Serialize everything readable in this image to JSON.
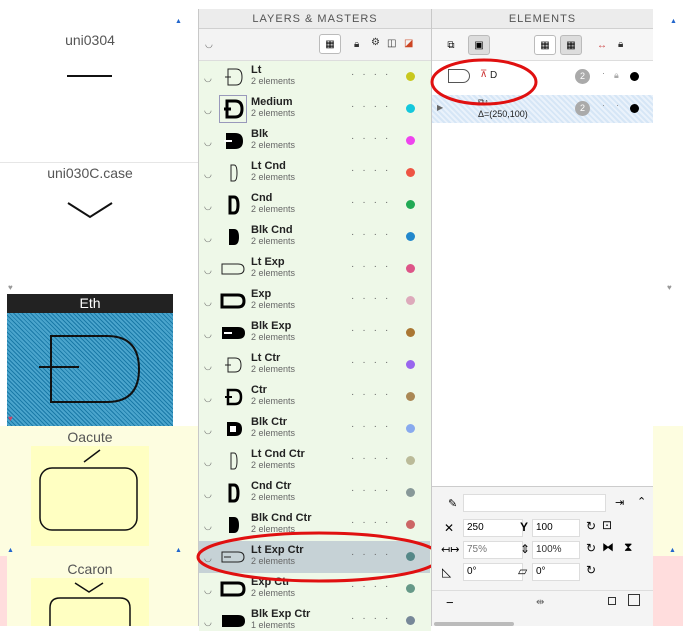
{
  "canvas": {
    "glyphs": [
      {
        "name": "uni0304"
      },
      {
        "name": "uni030C.case"
      },
      {
        "name": "Eth"
      },
      {
        "name": "Oacute"
      },
      {
        "name": "Ccaron"
      }
    ]
  },
  "layers_panel": {
    "title": "LAYERS & MASTERS",
    "layers": [
      {
        "name": "Lt",
        "sub": "2 elements",
        "color": "#c8c81e"
      },
      {
        "name": "Medium",
        "sub": "2 elements",
        "color": "#14c8dc"
      },
      {
        "name": "Blk",
        "sub": "2 elements",
        "color": "#ee44ee"
      },
      {
        "name": "Lt Cnd",
        "sub": "2 elements",
        "color": "#ee5544"
      },
      {
        "name": "Cnd",
        "sub": "2 elements",
        "color": "#22aa55"
      },
      {
        "name": "Blk Cnd",
        "sub": "2 elements",
        "color": "#2288cc"
      },
      {
        "name": "Lt Exp",
        "sub": "2 elements",
        "color": "#dd5588"
      },
      {
        "name": "Exp",
        "sub": "2 elements",
        "color": "#ddaabb"
      },
      {
        "name": "Blk Exp",
        "sub": "2 elements",
        "color": "#aa7733"
      },
      {
        "name": "Lt Ctr",
        "sub": "2 elements",
        "color": "#9966ee"
      },
      {
        "name": "Ctr",
        "sub": "2 elements",
        "color": "#aa8855"
      },
      {
        "name": "Blk Ctr",
        "sub": "2 elements",
        "color": "#88aaee"
      },
      {
        "name": "Lt Cnd Ctr",
        "sub": "2 elements",
        "color": "#bbbb99"
      },
      {
        "name": "Cnd Ctr",
        "sub": "2 elements",
        "color": "#889999"
      },
      {
        "name": "Blk Cnd Ctr",
        "sub": "2 elements",
        "color": "#cc6666"
      },
      {
        "name": "Lt Exp Ctr",
        "sub": "2 elements",
        "color": "#558888"
      },
      {
        "name": "Exp Ctr",
        "sub": "2 elements",
        "color": "#669988"
      },
      {
        "name": "Blk Exp Ctr",
        "sub": "1 elements",
        "color": "#778899"
      }
    ]
  },
  "elements_panel": {
    "title": "ELEMENTS",
    "items": [
      {
        "label": "D",
        "badge": "2"
      },
      {
        "label": "Δ=(250,100)",
        "badge": "2"
      }
    ]
  },
  "transform": {
    "x": "250",
    "y": "100",
    "scale_x": "75%",
    "scale_y": "100%",
    "rotate": "0°",
    "slant": "0°"
  }
}
